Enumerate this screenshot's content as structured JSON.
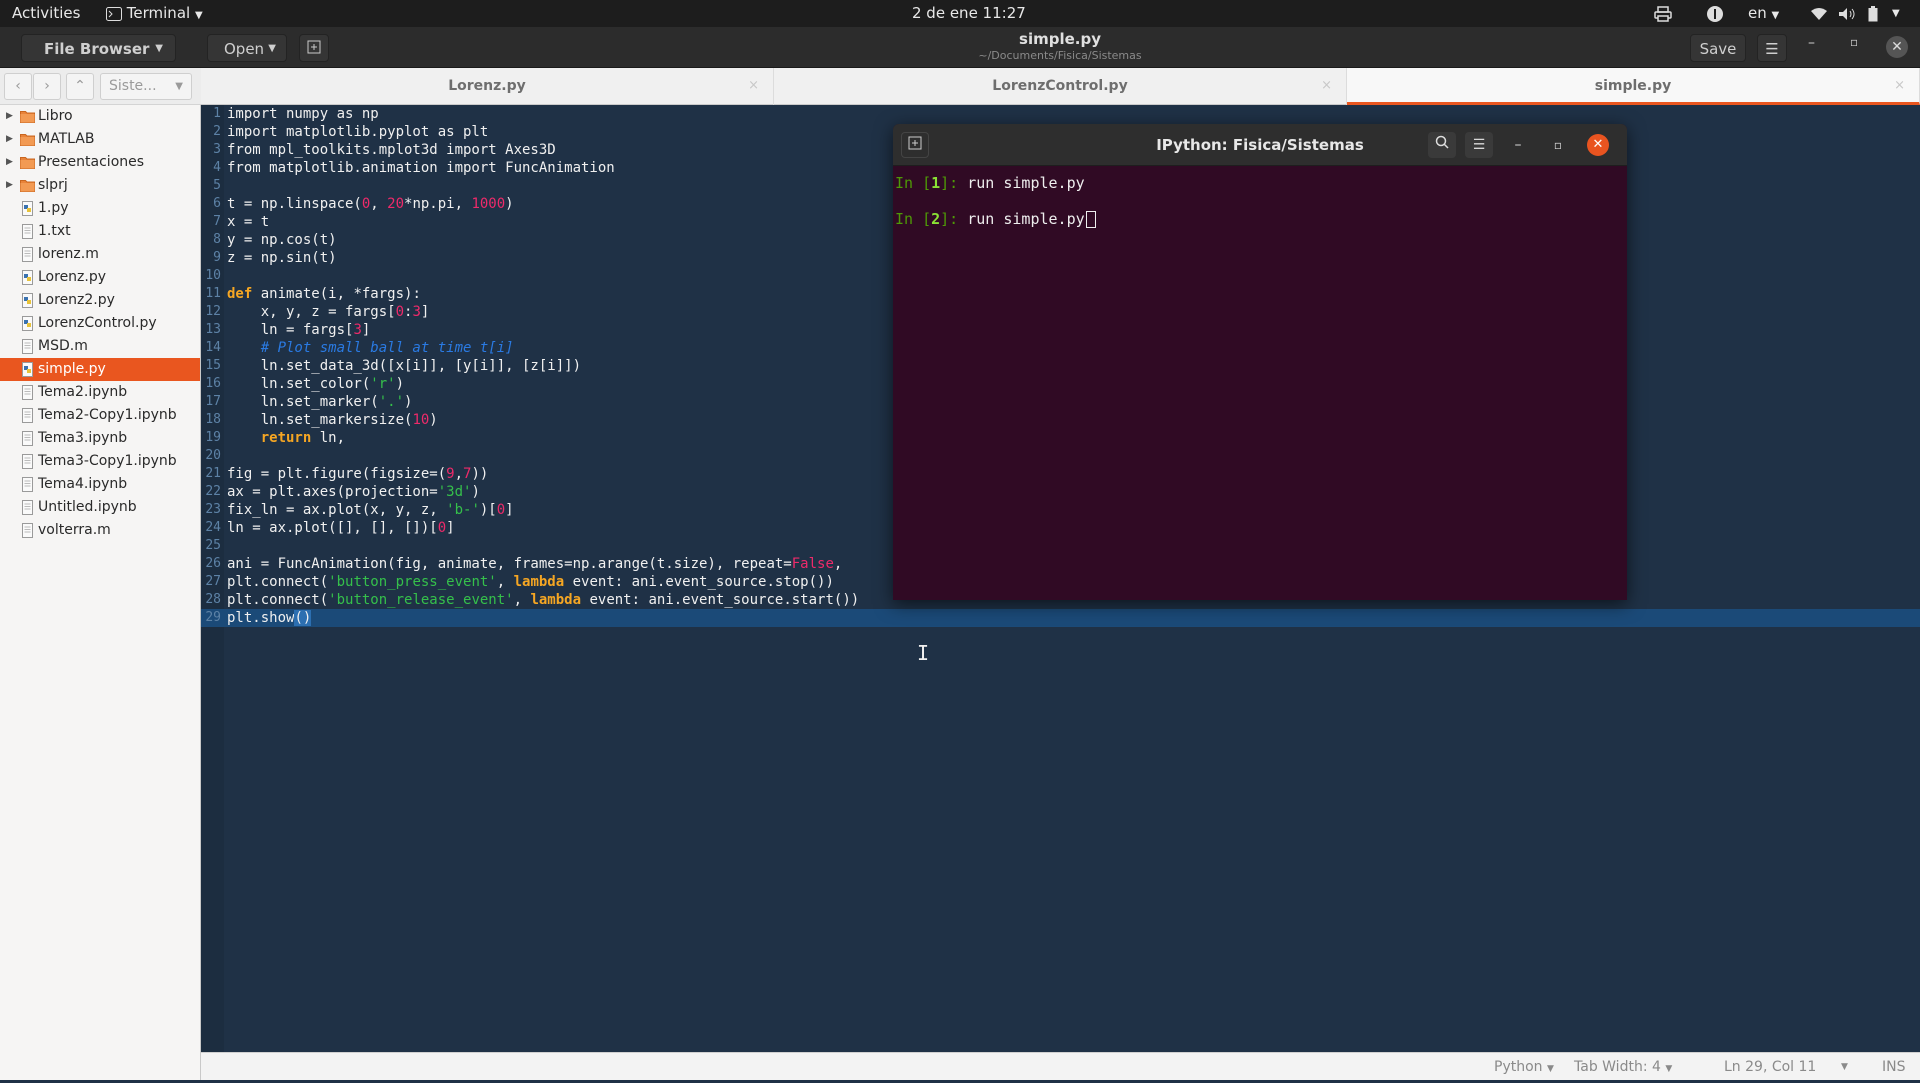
{
  "topbar": {
    "activities": "Activities",
    "app_menu": "Terminal",
    "clock": "2 de ene  11:27",
    "language": "en"
  },
  "header": {
    "file_browser_label": "File Browser",
    "open_label": "Open",
    "title": "simple.py",
    "subtitle": "~/Documents/Fisica/Sistemas",
    "save_label": "Save"
  },
  "sidebar": {
    "dir_selector": "Siste...",
    "items": [
      {
        "name": "Libro",
        "type": "folder"
      },
      {
        "name": "MATLAB",
        "type": "folder"
      },
      {
        "name": "Presentaciones",
        "type": "folder"
      },
      {
        "name": "slprj",
        "type": "folder"
      },
      {
        "name": "1.py",
        "type": "python"
      },
      {
        "name": "1.txt",
        "type": "text"
      },
      {
        "name": "lorenz.m",
        "type": "text"
      },
      {
        "name": "Lorenz.py",
        "type": "python"
      },
      {
        "name": "Lorenz2.py",
        "type": "python"
      },
      {
        "name": "LorenzControl.py",
        "type": "python"
      },
      {
        "name": "MSD.m",
        "type": "text"
      },
      {
        "name": "simple.py",
        "type": "python",
        "selected": true
      },
      {
        "name": "Tema2.ipynb",
        "type": "text"
      },
      {
        "name": "Tema2-Copy1.ipynb",
        "type": "text"
      },
      {
        "name": "Tema3.ipynb",
        "type": "text"
      },
      {
        "name": "Tema3-Copy1.ipynb",
        "type": "text"
      },
      {
        "name": "Tema4.ipynb",
        "type": "text"
      },
      {
        "name": "Untitled.ipynb",
        "type": "text"
      },
      {
        "name": "volterra.m",
        "type": "text"
      }
    ]
  },
  "tabs": [
    {
      "label": "Lorenz.py",
      "close": "×"
    },
    {
      "label": "LorenzControl.py",
      "close": "×"
    },
    {
      "label": "simple.py",
      "close": "×",
      "active": true
    }
  ],
  "editor": {
    "current_line": 29,
    "lines": [
      [
        [
          "kw0",
          "import numpy "
        ],
        [
          "kw0",
          "as"
        ],
        [
          "p",
          " np"
        ]
      ],
      [
        [
          "p",
          "import matplotlib.pyplot as plt"
        ]
      ],
      [
        [
          "p",
          "from mpl_toolkits.mplot3d import Axes3D"
        ]
      ],
      [
        [
          "p",
          "from matplotlib.animation import FuncAnimation"
        ]
      ],
      [
        [
          "p",
          ""
        ]
      ],
      [
        [
          "p",
          "t = np.linspace("
        ],
        [
          "num",
          "0"
        ],
        [
          "p",
          ", "
        ],
        [
          "num",
          "20"
        ],
        [
          "p",
          "*np.pi, "
        ],
        [
          "num",
          "1000"
        ],
        [
          "p",
          ")"
        ]
      ],
      [
        [
          "p",
          "x = t"
        ]
      ],
      [
        [
          "p",
          "y = np.cos(t)"
        ]
      ],
      [
        [
          "p",
          "z = np.sin(t)"
        ]
      ],
      [
        [
          "p",
          ""
        ]
      ],
      [
        [
          "kw",
          "def"
        ],
        [
          "p",
          " animate(i, *fargs):"
        ]
      ],
      [
        [
          "p",
          "    x, y, z = fargs["
        ],
        [
          "num",
          "0"
        ],
        [
          "p",
          ":"
        ],
        [
          "num",
          "3"
        ],
        [
          "p",
          "]"
        ]
      ],
      [
        [
          "p",
          "    ln = fargs["
        ],
        [
          "num",
          "3"
        ],
        [
          "p",
          "]"
        ]
      ],
      [
        [
          "cmt",
          "    # Plot small ball at time t[i]"
        ]
      ],
      [
        [
          "p",
          "    ln.set_data_3d([x[i]], [y[i]], [z[i]])"
        ]
      ],
      [
        [
          "p",
          "    ln.set_color("
        ],
        [
          "str",
          "'r'"
        ],
        [
          "p",
          ")"
        ]
      ],
      [
        [
          "p",
          "    ln.set_marker("
        ],
        [
          "str",
          "'.'"
        ],
        [
          "p",
          ")"
        ]
      ],
      [
        [
          "p",
          "    ln.set_markersize("
        ],
        [
          "num",
          "10"
        ],
        [
          "p",
          ")"
        ]
      ],
      [
        [
          "kw",
          "    return"
        ],
        [
          "p",
          " ln,"
        ]
      ],
      [
        [
          "p",
          ""
        ]
      ],
      [
        [
          "p",
          "fig = plt.figure(figsize=("
        ],
        [
          "num",
          "9"
        ],
        [
          "p",
          ","
        ],
        [
          "num",
          "7"
        ],
        [
          "p",
          "))"
        ]
      ],
      [
        [
          "p",
          "ax = plt.axes(projection="
        ],
        [
          "str",
          "'3d'"
        ],
        [
          "p",
          ")"
        ]
      ],
      [
        [
          "p",
          "fix_ln = ax.plot(x, y, z, "
        ],
        [
          "str",
          "'b-'"
        ],
        [
          "p",
          ")["
        ],
        [
          "num",
          "0"
        ],
        [
          "p",
          "]"
        ]
      ],
      [
        [
          "p",
          "ln = ax.plot([], [], [])["
        ],
        [
          "num",
          "0"
        ],
        [
          "p",
          "]"
        ]
      ],
      [
        [
          "p",
          ""
        ]
      ],
      [
        [
          "p",
          "ani = FuncAnimation(fig, animate, frames=np.arange(t.size), repeat="
        ],
        [
          "num",
          "False"
        ],
        [
          "p",
          ","
        ]
      ],
      [
        [
          "p",
          "plt.connect("
        ],
        [
          "str",
          "'button_press_event'"
        ],
        [
          "p",
          ", "
        ],
        [
          "kw",
          "lambda"
        ],
        [
          "p",
          " event: ani.event_source.stop())"
        ]
      ],
      [
        [
          "p",
          "plt.connect("
        ],
        [
          "str",
          "'button_release_event'"
        ],
        [
          "p",
          ", "
        ],
        [
          "kw",
          "lambda"
        ],
        [
          "p",
          " event: ani.event_source.start())"
        ]
      ],
      [
        [
          "p",
          "plt.show"
        ],
        [
          "hl",
          "()"
        ]
      ]
    ]
  },
  "statusbar": {
    "language": "Python",
    "tab_width": "Tab Width: 4",
    "position": "Ln 29, Col 11",
    "mode": "INS"
  },
  "terminal": {
    "title": "IPython: Fisica/Sistemas",
    "lines": [
      {
        "in": "In [",
        "num": "1",
        "end": "]: ",
        "cmd": "run simple.py"
      },
      {
        "in": "In [",
        "num": "2",
        "end": "]: ",
        "cmd": "run simple.py"
      }
    ]
  }
}
